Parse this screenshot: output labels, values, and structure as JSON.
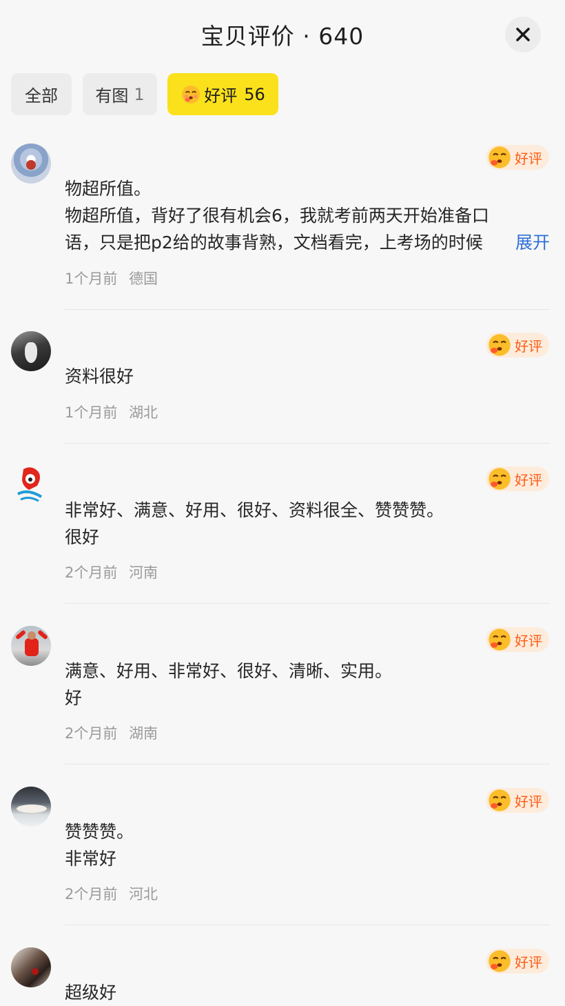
{
  "header": {
    "title": "宝贝评价 · 640",
    "close_icon": "close-icon"
  },
  "tabs": [
    {
      "label": "全部",
      "count": ""
    },
    {
      "label": "有图",
      "count": "1"
    },
    {
      "label": "好评",
      "count": "56",
      "icon": "smiling-face-icon"
    }
  ],
  "badge_label": "好评",
  "reviews": [
    {
      "lines": [
        "物超所值。",
        "物超所值，背好了很有机会6，我就考前两天开始准备口"
      ],
      "clipped_line": "语，只是把p2给的故事背熟，文档看完，上考场的时候",
      "expand_label": "展开",
      "time": "1个月前",
      "location": "德国"
    },
    {
      "lines": [
        "资料很好"
      ],
      "time": "1个月前",
      "location": "湖北"
    },
    {
      "lines": [
        "非常好、满意、好用、很好、资料很全、赞赞赞。",
        "很好"
      ],
      "time": "2个月前",
      "location": "河南"
    },
    {
      "lines": [
        "满意、好用、非常好、很好、清晰、实用。",
        "好"
      ],
      "time": "2个月前",
      "location": "湖南"
    },
    {
      "lines": [
        "赞赞赞。",
        "非常好"
      ],
      "time": "2个月前",
      "location": "河北"
    },
    {
      "lines": [
        "超级好"
      ]
    }
  ],
  "colors": {
    "accent_tab": "#fbe11c",
    "badge_text": "#ff5a14",
    "link": "#2f6fd8"
  }
}
